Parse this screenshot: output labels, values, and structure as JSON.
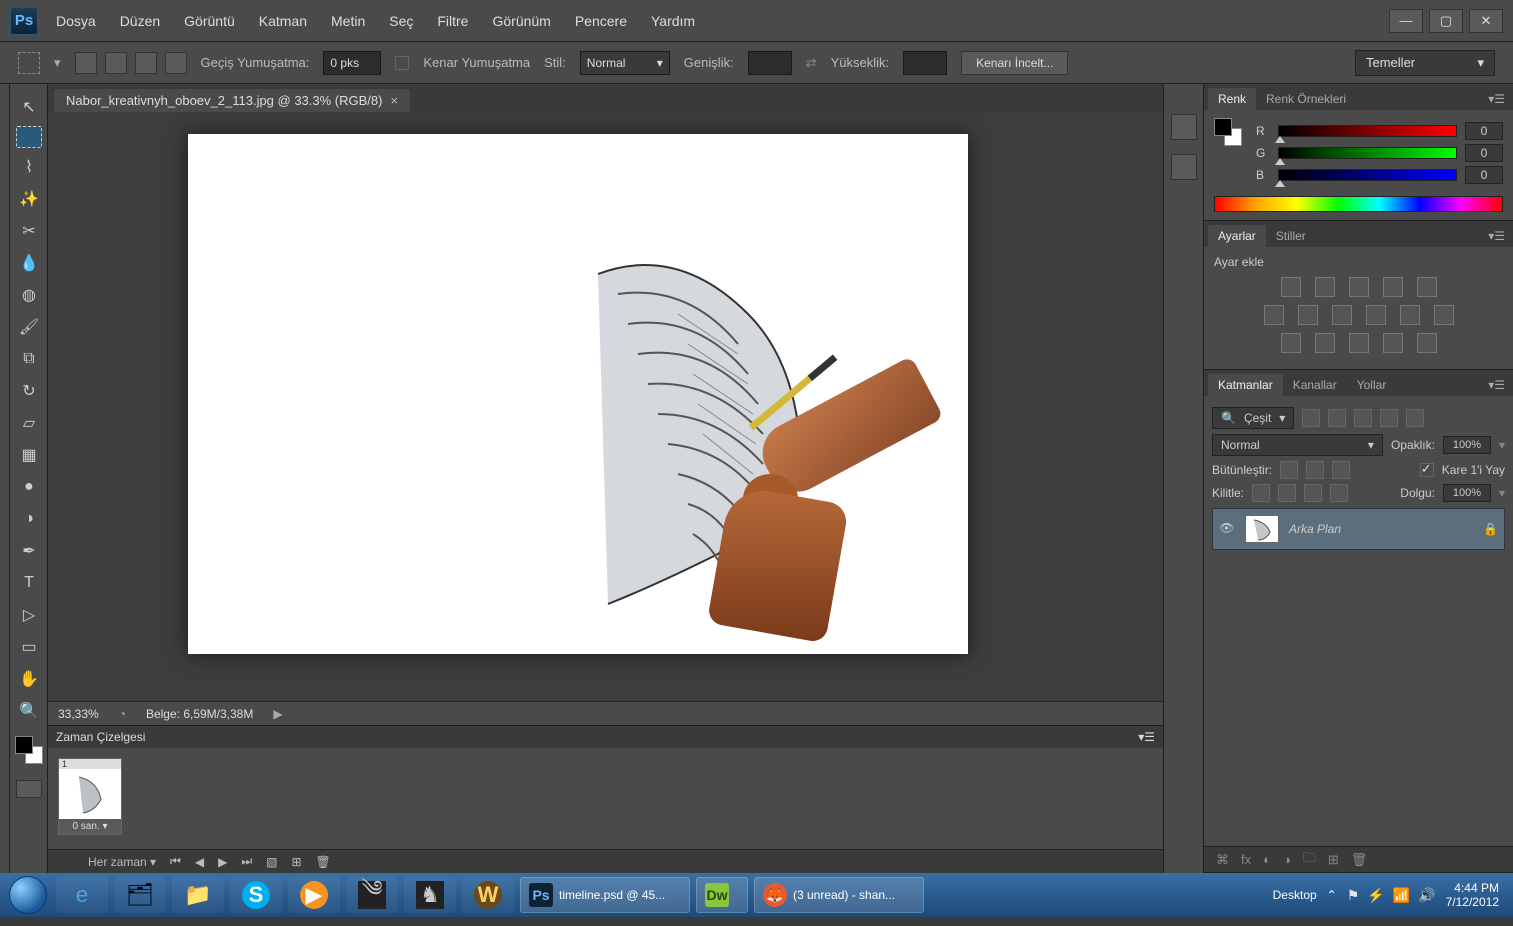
{
  "app": {
    "logo": "Ps"
  },
  "menu": [
    "Dosya",
    "Düzen",
    "Görüntü",
    "Katman",
    "Metin",
    "Seç",
    "Filtre",
    "Görünüm",
    "Pencere",
    "Yardım"
  ],
  "options": {
    "transition_label": "Geçiş Yumuşatma:",
    "transition_value": "0 pks",
    "anti_alias": "Kenar Yumuşatma",
    "style_label": "Stil:",
    "style_value": "Normal",
    "width_label": "Genişlik:",
    "height_label": "Yükseklik:",
    "refine_edge": "Kenarı İncelt...",
    "workspace_preset": "Temeller"
  },
  "document": {
    "tab_title": "Nabor_kreativnyh_oboev_2_113.jpg @ 33.3% (RGB/8)",
    "zoom": "33,33%",
    "doc_size": "Belge: 6,59M/3,38M"
  },
  "timeline": {
    "title": "Zaman Çizelgesi",
    "frame_label": "1",
    "duration": "0 san.",
    "loop": "Her zaman"
  },
  "panels": {
    "color": {
      "tab_a": "Renk",
      "tab_b": "Renk Örnekleri",
      "r_label": "R",
      "r_val": "0",
      "g_label": "G",
      "g_val": "0",
      "b_label": "B",
      "b_val": "0"
    },
    "adjust": {
      "tab_a": "Ayarlar",
      "tab_b": "Stiller",
      "add_label": "Ayar ekle"
    },
    "layers": {
      "tab_a": "Katmanlar",
      "tab_b": "Kanallar",
      "tab_c": "Yollar",
      "filter": "Çeşit",
      "blend_mode": "Normal",
      "opacity_label": "Opaklık:",
      "opacity_value": "100%",
      "unify_label": "Bütünleştir:",
      "propagate": "Kare 1'i Yay",
      "lock_label": "Kilitle:",
      "fill_label": "Dolgu:",
      "fill_value": "100%",
      "layer_name": "Arka Plan"
    }
  },
  "taskbar": {
    "desktop": "Desktop",
    "items": [
      {
        "label": "timeline.psd @ 45..."
      },
      {
        "label": "(3 unread) - shan..."
      }
    ],
    "time": "4:44 PM",
    "date": "7/12/2012"
  }
}
